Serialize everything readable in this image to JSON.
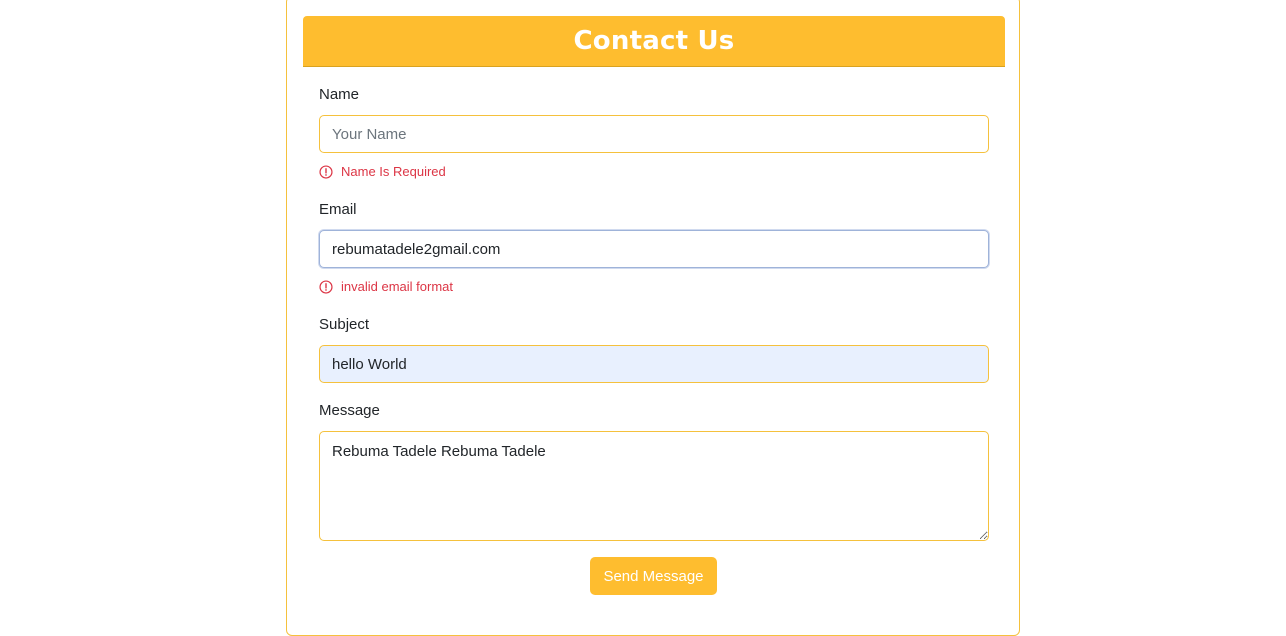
{
  "form": {
    "title": "Contact Us",
    "name": {
      "label": "Name",
      "placeholder": "Your Name",
      "value": "",
      "error": "Name Is Required"
    },
    "email": {
      "label": "Email",
      "value": "rebumatadele2gmail.com",
      "error": "invalid email format"
    },
    "subject": {
      "label": "Subject",
      "value": "hello World"
    },
    "message": {
      "label": "Message",
      "value": "Rebuma Tadele Rebuma Tadele"
    },
    "submit_label": "Send Message"
  },
  "colors": {
    "accent": "#febd2f",
    "error": "#dc3545",
    "autofill": "#e8f0fe"
  },
  "icons": {
    "error": "exclamation-circle-icon"
  }
}
